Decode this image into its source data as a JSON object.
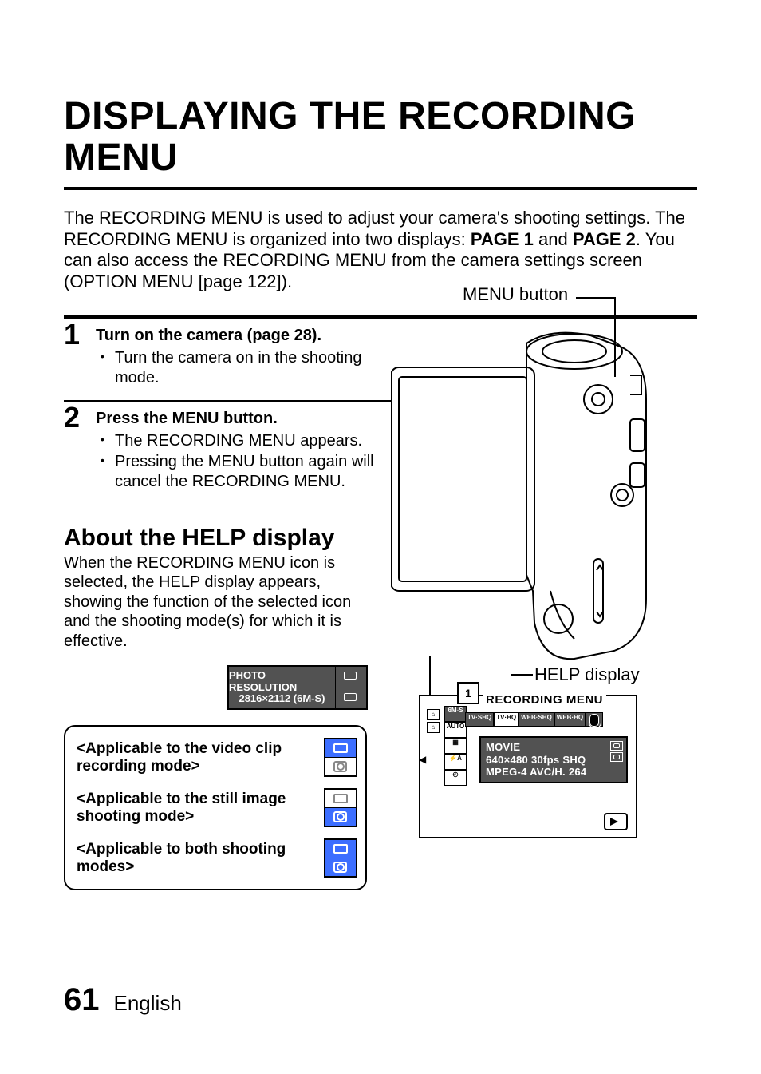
{
  "title": "DISPLAYING THE RECORDING MENU",
  "intro": {
    "line1": "The RECORDING MENU is used to adjust your camera's shooting settings.",
    "line2a": "The RECORDING MENU is organized into two displays: ",
    "page1": "PAGE 1",
    "and": " and ",
    "page2_prefix": "PAGE 2",
    "line3": ". You can also access the RECORDING MENU from the camera settings screen (OPTION MENU [page 122])."
  },
  "steps": [
    {
      "num": "1",
      "head": "Turn on the camera (page 28).",
      "bullets": [
        "Turn the camera on in the shooting mode."
      ]
    },
    {
      "num": "2",
      "head": "Press the MENU button.",
      "bullets": [
        "The RECORDING MENU appears.",
        "Pressing the MENU button again will cancel the RECORDING MENU."
      ]
    }
  ],
  "help": {
    "head": "About the HELP display",
    "body": "When the RECORDING MENU icon is selected, the HELP display appears, showing the function of the selected icon and the shooting mode(s) for which it is effective."
  },
  "labels": {
    "menu_button": "MENU button",
    "help_display": "HELP display"
  },
  "photo_chip": {
    "line1": "PHOTO RESOLUTION",
    "line2": "2816×2112 (6M-S)"
  },
  "legend": [
    "<Applicable to the video clip recording mode>",
    "<Applicable to the still image shooting mode>",
    "<Applicable to both shooting modes>"
  ],
  "screen": {
    "title": "RECORDING MENU",
    "page_chip": "1",
    "side_col": [
      "6M-S",
      "AUTO",
      "",
      "A",
      ""
    ],
    "tabs": [
      "TV·SHQ",
      "TV·HQ",
      "WEB·SHQ",
      "WEB·HQ"
    ],
    "highlight": {
      "l1": "MOVIE",
      "l2": "640×480 30fps SHQ",
      "l3": "MPEG-4 AVC/H. 264"
    }
  },
  "footer": {
    "page": "61",
    "language": "English"
  }
}
